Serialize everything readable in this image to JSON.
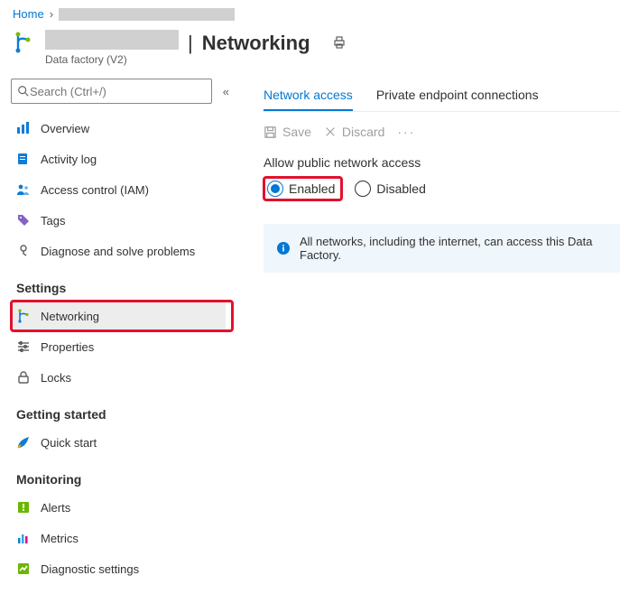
{
  "breadcrumb": {
    "home": "Home"
  },
  "header": {
    "separator": "|",
    "page_title": "Networking",
    "subtitle": "Data factory (V2)"
  },
  "sidebar": {
    "search_placeholder": "Search (Ctrl+/)",
    "items_top": [
      {
        "label": "Overview"
      },
      {
        "label": "Activity log"
      },
      {
        "label": "Access control (IAM)"
      },
      {
        "label": "Tags"
      },
      {
        "label": "Diagnose and solve problems"
      }
    ],
    "section_settings": "Settings",
    "items_settings": [
      {
        "label": "Networking"
      },
      {
        "label": "Properties"
      },
      {
        "label": "Locks"
      }
    ],
    "section_getting_started": "Getting started",
    "items_getting": [
      {
        "label": "Quick start"
      }
    ],
    "section_monitoring": "Monitoring",
    "items_monitoring": [
      {
        "label": "Alerts"
      },
      {
        "label": "Metrics"
      },
      {
        "label": "Diagnostic settings"
      }
    ]
  },
  "main": {
    "tabs": [
      {
        "label": "Network access",
        "active": true
      },
      {
        "label": "Private endpoint connections",
        "active": false
      }
    ],
    "toolbar": {
      "save": "Save",
      "discard": "Discard"
    },
    "field_label": "Allow public network access",
    "options": {
      "enabled": "Enabled",
      "disabled": "Disabled"
    },
    "selected_option": "enabled",
    "info": "All networks, including the internet, can access this Data Factory."
  }
}
